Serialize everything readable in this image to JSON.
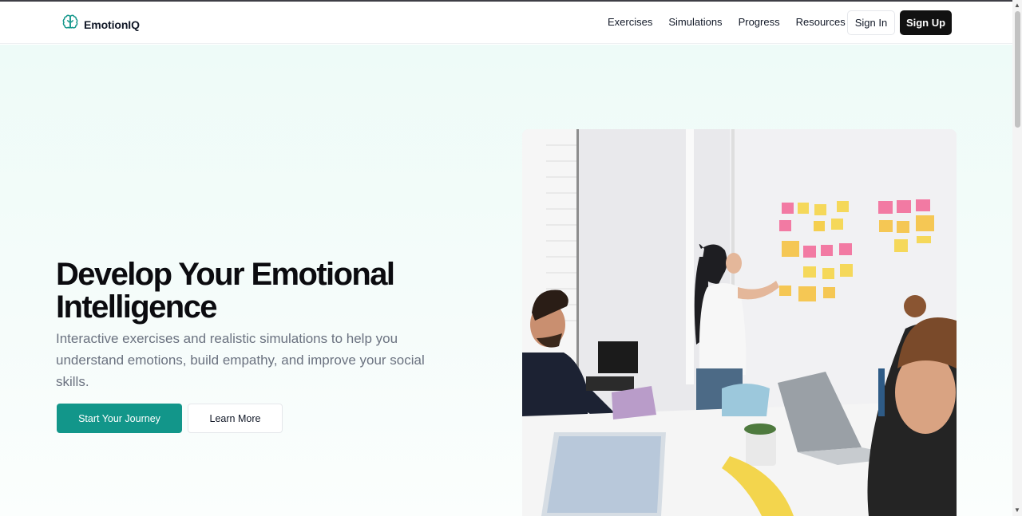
{
  "brand": {
    "name": "EmotionIQ",
    "logo_icon": "brain-icon",
    "accent": "#12968a"
  },
  "nav": {
    "links": [
      "Exercises",
      "Simulations",
      "Progress",
      "Resources"
    ],
    "sign_in": "Sign In",
    "sign_up": "Sign Up"
  },
  "hero": {
    "title": "Develop Your Emotional Intelligence",
    "subtitle": "Interactive exercises and realistic simulations to help you understand emotions, build empathy, and improve your social skills.",
    "primary_cta": "Start Your Journey",
    "secondary_cta": "Learn More",
    "image_subject": "team-meeting-photo"
  }
}
